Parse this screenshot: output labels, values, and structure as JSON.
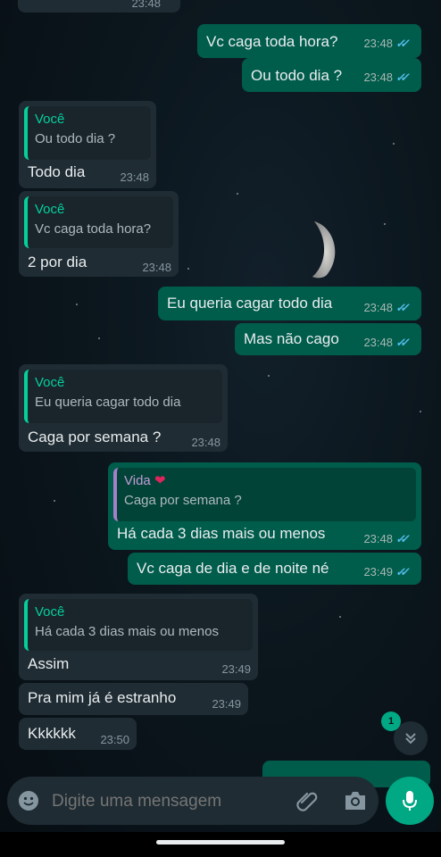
{
  "colors": {
    "outgoing_bubble": "#005c4b",
    "incoming_bubble": "#1f2c33",
    "accent_green": "#00a884",
    "read_ticks": "#53bdeb",
    "quote_author_self": "#06cf9c",
    "quote_author_contact": "#c39bd9"
  },
  "top_partial": {
    "time": "23:48"
  },
  "messages": [
    {
      "direction": "out",
      "text": "Vc caga toda hora?",
      "time": "23:48",
      "status_icon": "double-check-read"
    },
    {
      "direction": "out",
      "text": "Ou todo dia ?",
      "time": "23:48",
      "status_icon": "double-check-read"
    },
    {
      "direction": "in",
      "quote_author": "Você",
      "quote_text": "Ou todo dia ?",
      "text": "Todo dia",
      "time": "23:48"
    },
    {
      "direction": "in",
      "quote_author": "Você",
      "quote_text": "Vc caga toda hora?",
      "text": "2 por dia",
      "time": "23:48"
    },
    {
      "direction": "out",
      "text": "Eu queria cagar todo dia",
      "time": "23:48",
      "status_icon": "double-check-read"
    },
    {
      "direction": "out",
      "text": "Mas não cago",
      "time": "23:48",
      "status_icon": "double-check-read"
    },
    {
      "direction": "in",
      "quote_author": "Você",
      "quote_text": "Eu queria cagar todo dia",
      "text": "Caga por semana ?",
      "time": "23:48"
    },
    {
      "direction": "out",
      "quote_author": "Vida",
      "quote_author_icon": "red-heart-icon",
      "quote_text": "Caga por semana ?",
      "text": "Há cada 3 dias mais ou menos",
      "time": "23:48",
      "status_icon": "double-check-read"
    },
    {
      "direction": "out",
      "text": "Vc caga de dia e de noite né",
      "time": "23:49",
      "status_icon": "double-check-read"
    },
    {
      "direction": "in",
      "quote_author": "Você",
      "quote_text": "Há cada 3 dias mais ou menos",
      "text": "Assim",
      "time": "23:49"
    },
    {
      "direction": "in",
      "text": "Pra mim já é estranho",
      "time": "23:49"
    },
    {
      "direction": "in",
      "text": "Kkkkkk",
      "time": "23:50"
    }
  ],
  "scroll_down": {
    "unread_count": "1",
    "icon": "double-chevron-down-icon"
  },
  "input": {
    "placeholder": "Digite uma mensagem",
    "emoji_icon": "emoji-icon",
    "attach_icon": "paperclip-icon",
    "camera_icon": "camera-icon",
    "mic_icon": "microphone-icon"
  }
}
